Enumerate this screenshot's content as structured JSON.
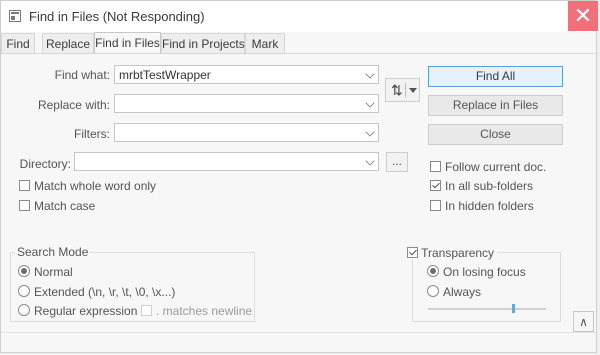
{
  "window": {
    "title": "Find in Files (Not Responding)",
    "close_glyph": "✕"
  },
  "tabs": [
    {
      "label": "Find",
      "active": false
    },
    {
      "label": "Replace",
      "active": false
    },
    {
      "label": "Find in Files",
      "active": true
    },
    {
      "label": "Find in Projects",
      "active": false
    },
    {
      "label": "Mark",
      "active": false
    }
  ],
  "form": {
    "find_what_label": "Find what:",
    "find_what_value": "mrbtTestWrapper",
    "replace_with_label": "Replace with:",
    "replace_with_value": "",
    "filters_label": "Filters:",
    "filters_value": "",
    "directory_label": "Directory:",
    "directory_value": "",
    "browse_label": "...",
    "swap_glyph": "⇅"
  },
  "buttons": {
    "find_all": "Find All",
    "replace_in_files": "Replace in Files",
    "close": "Close"
  },
  "options": {
    "match_whole_word": {
      "label": "Match whole word only",
      "checked": false
    },
    "match_case": {
      "label": "Match case",
      "checked": false
    },
    "follow_current_doc": {
      "label": "Follow current doc.",
      "checked": false
    },
    "in_all_subfolders": {
      "label": "In all sub-folders",
      "checked": true
    },
    "in_hidden_folders": {
      "label": "In hidden folders",
      "checked": false
    }
  },
  "search_mode": {
    "title": "Search Mode",
    "normal": {
      "label": "Normal",
      "selected": true
    },
    "extended": {
      "label": "Extended (\\n, \\r, \\t, \\0, \\x...)",
      "selected": false
    },
    "regex": {
      "label": "Regular expression",
      "selected": false
    },
    "matches_newline": {
      "label": ". matches newline",
      "checked": false,
      "enabled": false
    }
  },
  "transparency": {
    "title": "Transparency",
    "enabled": true,
    "on_losing_focus": {
      "label": "On losing focus",
      "selected": true
    },
    "always": {
      "label": "Always",
      "selected": false
    },
    "level": 0.72
  },
  "corner_button_glyph": "∧",
  "colors": {
    "close_button": "#f1707a",
    "primary_border": "#5aa0d8",
    "slider_thumb": "#6aa7dd"
  }
}
